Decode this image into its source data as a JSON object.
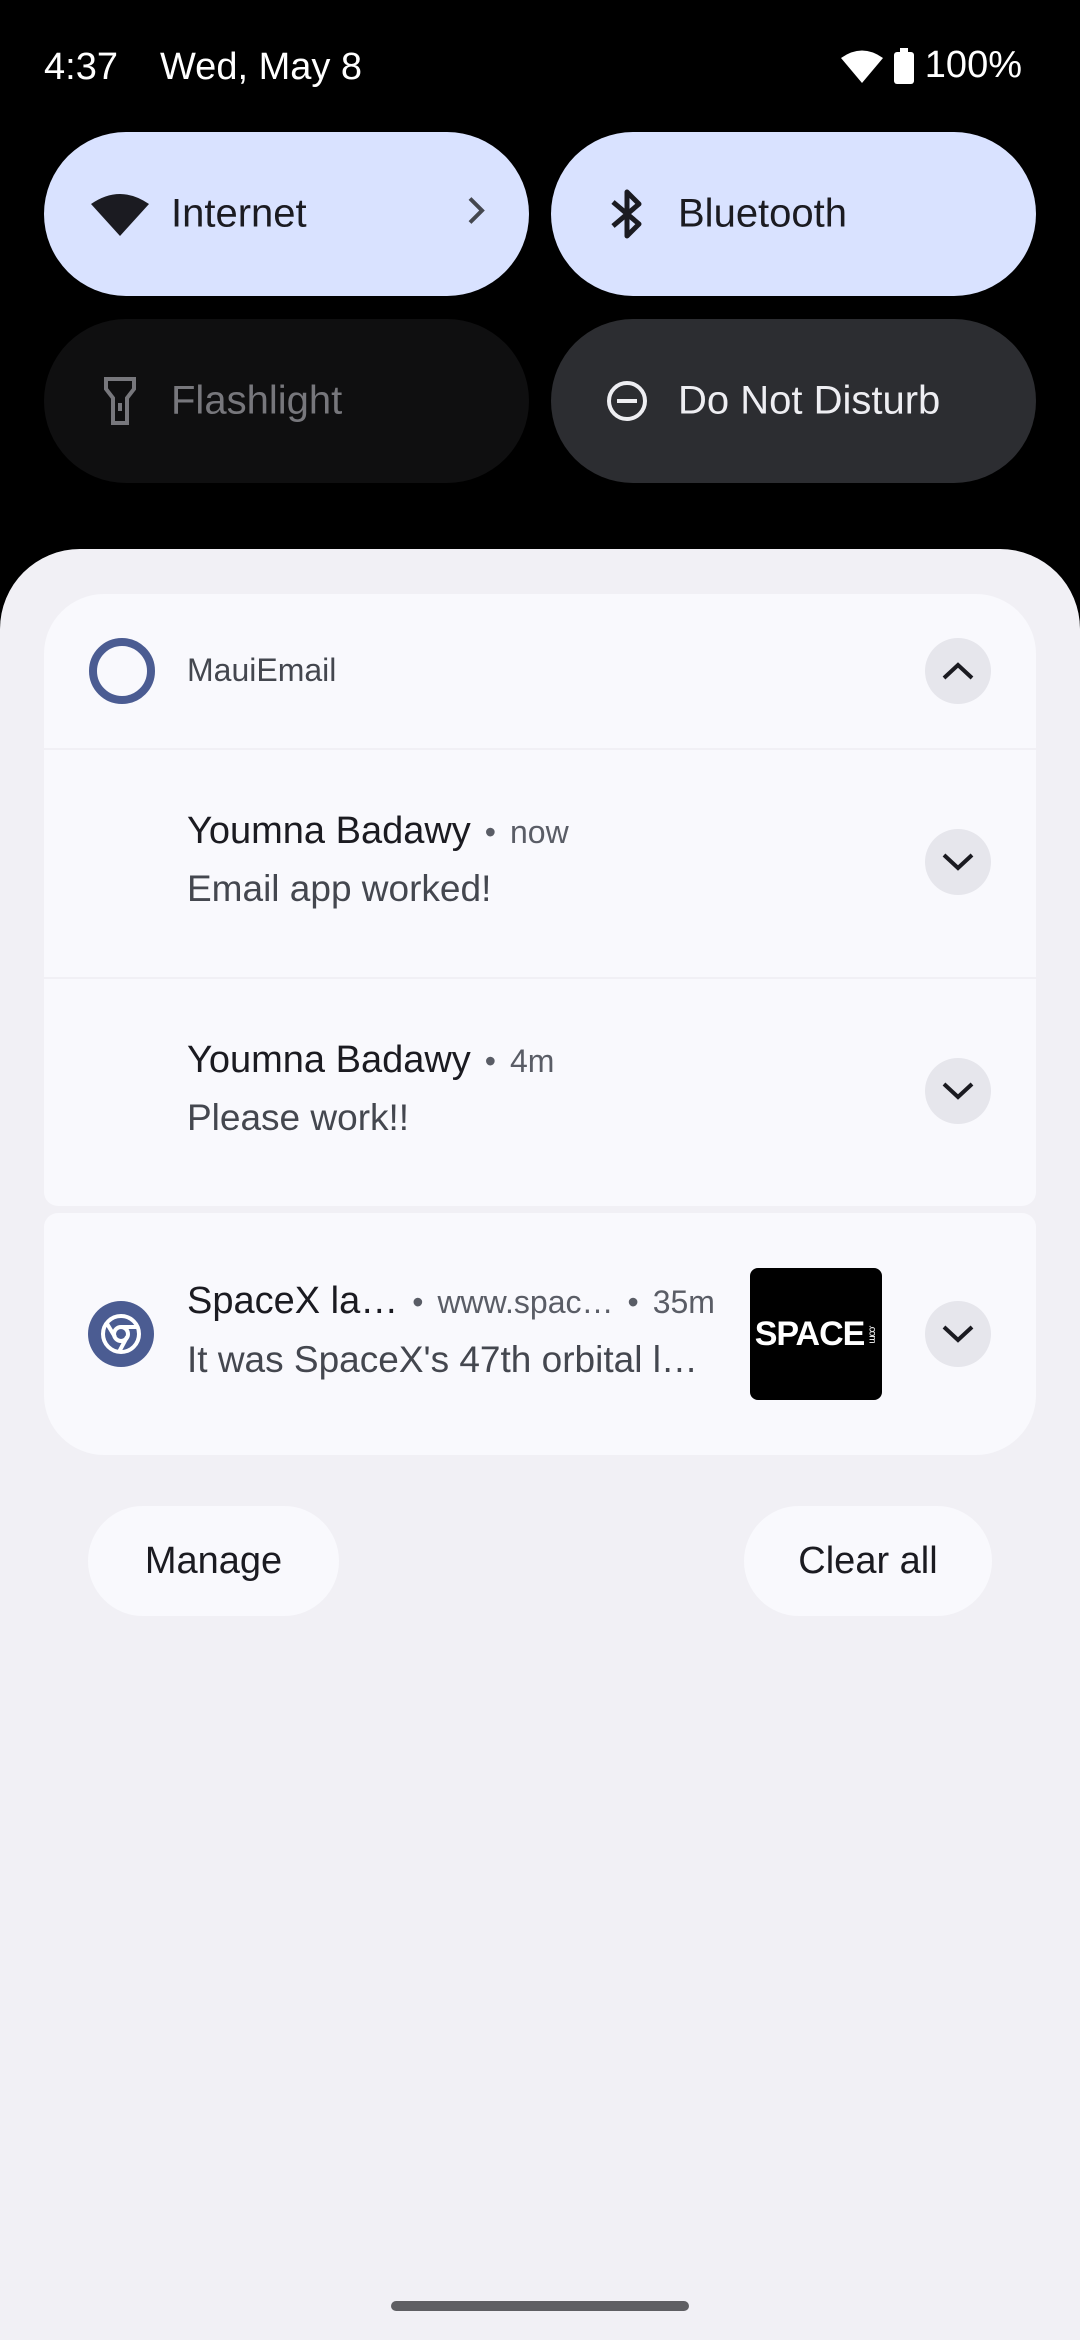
{
  "status": {
    "time": "4:37",
    "date": "Wed, May 8",
    "battery": "100%"
  },
  "tiles": {
    "internet": "Internet",
    "bluetooth": "Bluetooth",
    "flashlight": "Flashlight",
    "dnd": "Do Not Disturb"
  },
  "group": {
    "app_name": "MauiEmail",
    "items": [
      {
        "sender": "Youmna Badawy",
        "time": "now",
        "body": "Email app worked!"
      },
      {
        "sender": "Youmna Badawy",
        "time": "4m",
        "body": "Please work!!"
      }
    ]
  },
  "chrome_notif": {
    "title": "SpaceX la…",
    "site": "www.spac…",
    "time": "35m",
    "body": "It was SpaceX's 47th orbital l…",
    "thumb_text": "SPACE",
    "thumb_small": ".com"
  },
  "footer": {
    "manage": "Manage",
    "clear_all": "Clear all"
  },
  "separator": "•",
  "colors": {
    "tile_on": "#d9e2ff",
    "accent": "#4b5c92",
    "shade_bg": "#f1f0f5"
  }
}
